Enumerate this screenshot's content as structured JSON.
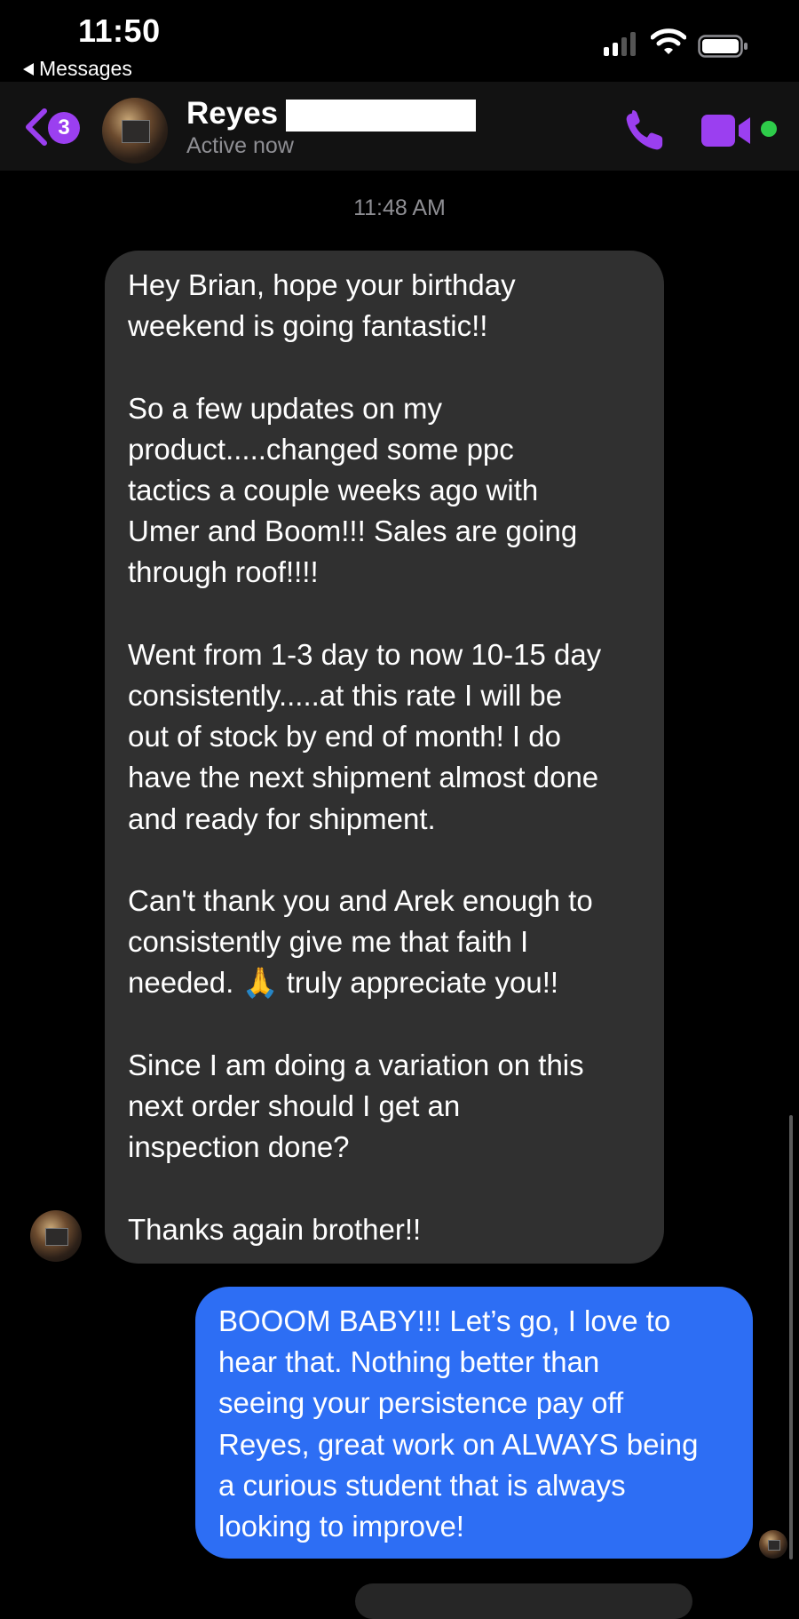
{
  "status_bar": {
    "time": "11:50",
    "back_app": "Messages"
  },
  "header": {
    "back_badge_count": "3",
    "contact_name": "Reyes",
    "status": "Active now",
    "accent_color": "#9b3ff0",
    "online_color": "#2ecc4a",
    "icons": [
      "chevron-left-icon",
      "phone-icon",
      "video-camera-icon"
    ]
  },
  "conversation": {
    "timestamp": "11:48 AM",
    "incoming_message": "Hey Brian, hope your birthday\nweekend is going fantastic!!\n\nSo a few updates on my\nproduct.....changed some ppc\ntactics a couple weeks ago with\nUmer and Boom!!! Sales are going\nthrough roof!!!!\n\nWent from 1-3 day to now 10-15 day\nconsistently.....at this rate I will be\nout of stock by end of month! I do\nhave the next shipment almost done\nand ready for shipment.\n\nCan't thank you and Arek enough to\nconsistently give me that faith I\nneeded. 🙏 truly appreciate you!!\n\nSince I am doing a variation on this\nnext order should I get an\ninspection done?\n\nThanks again brother!!",
    "outgoing_message": "BOOOM BABY!!! Let’s go, I love to\nhear that. Nothing better than\nseeing your persistence pay off\nReyes, great work on ALWAYS being\na curious student that is always\nlooking to improve!",
    "incoming_bubble_color": "#303030",
    "outgoing_bubble_color": "#2d6ef4"
  }
}
